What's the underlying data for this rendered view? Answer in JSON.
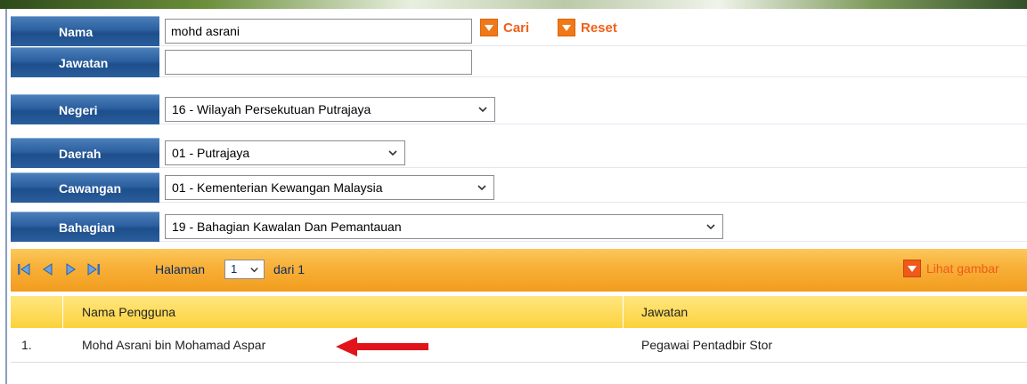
{
  "form": {
    "nama": {
      "label": "Nama",
      "value": "mohd asrani"
    },
    "jawatan": {
      "label": "Jawatan",
      "value": ""
    },
    "negeri": {
      "label": "Negeri",
      "value": "16 - Wilayah Persekutuan Putrajaya"
    },
    "daerah": {
      "label": "Daerah",
      "value": "01 - Putrajaya"
    },
    "cawangan": {
      "label": "Cawangan",
      "value": "01 - Kementerian Kewangan Malaysia"
    },
    "bahagian": {
      "label": "Bahagian",
      "value": "19 - Bahagian Kawalan Dan Pemantauan"
    },
    "cari_label": "Cari",
    "reset_label": "Reset"
  },
  "pager": {
    "halaman_label": "Halaman",
    "current_page": "1",
    "dari_label": "dari 1",
    "lihat_gambar_label": "Lihat gambar"
  },
  "table": {
    "columns": [
      "Nama Pengguna",
      "Jawatan"
    ],
    "rows": [
      {
        "no": "1.",
        "nama": "Mohd Asrani bin Mohamad Aspar",
        "jawatan": "Pegawai Pentadbir Stor"
      }
    ]
  },
  "colors": {
    "label_blue": "#2b5f9f",
    "orange_accent": "#f07818",
    "pager_orange": "#f8b13a",
    "header_yellow": "#fcd23c",
    "annotation_red": "#e0141a"
  }
}
